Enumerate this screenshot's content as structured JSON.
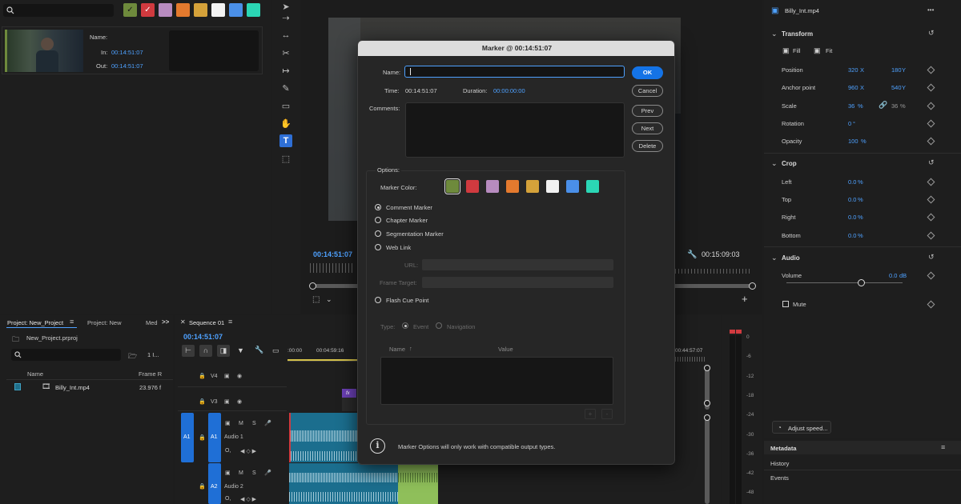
{
  "source_panel": {
    "search_placeholder": "",
    "label_colors": [
      "#6e8a3c",
      "#d03a3f",
      "#b78bbf",
      "#e47a2e",
      "#d5a23a",
      "#f2f2f2",
      "#4a8fe8",
      "#2bd6b5"
    ],
    "name_label": "Name:",
    "in_label": "In:",
    "in_value": "00:14:51:07",
    "out_label": "Out:",
    "out_value": "00:14:51:07"
  },
  "program_monitor": {
    "current_time": "00:14:51:07",
    "duration": "00:15:09:03"
  },
  "dialog": {
    "title": "Marker @ 00:14:51:07",
    "name_label": "Name:",
    "name_value": "",
    "time_label": "Time:",
    "time_value": "00:14:51:07",
    "duration_label": "Duration:",
    "duration_value": "00:00:00:00",
    "comments_label": "Comments:",
    "ok": "OK",
    "cancel": "Cancel",
    "prev": "Prev",
    "next": "Next",
    "delete": "Delete",
    "options_label": "Options:",
    "marker_color_label": "Marker Color:",
    "marker_colors": [
      "#6e8a3c",
      "#d03a3f",
      "#b78bbf",
      "#e47a2e",
      "#d5a23a",
      "#f2f2f2",
      "#4a8fe8",
      "#2bd6b5"
    ],
    "marker_types": [
      "Comment Marker",
      "Chapter Marker",
      "Segmentation Marker",
      "Web Link"
    ],
    "url_label": "URL:",
    "frame_target_label": "Frame Target:",
    "flash_cue_label": "Flash Cue Point",
    "type_label": "Type:",
    "type_event": "Event",
    "type_navigation": "Navigation",
    "col_name": "Name",
    "col_value": "Value",
    "add_symbol": "+",
    "remove_symbol": "-",
    "info_text": "Marker Options will only work with compatible output types."
  },
  "effect_controls": {
    "clip_name": "Billy_Int.mp4",
    "menu_glyph": "•••",
    "transform_label": "Transform",
    "fill_label": "Fill",
    "fit_label": "Fit",
    "position_label": "Position",
    "position_x": "320",
    "position_y": "180",
    "anchor_label": "Anchor point",
    "anchor_x": "960",
    "anchor_y": "540",
    "x_unit": "X",
    "y_unit": "Y",
    "scale_label": "Scale",
    "scale_value": "36",
    "scale_value2": "36",
    "pct_unit": "%",
    "rotation_label": "Rotation",
    "rotation_value": "0",
    "deg_unit": "°",
    "opacity_label": "Opacity",
    "opacity_value": "100",
    "crop_label": "Crop",
    "crop_left_label": "Left",
    "crop_left": "0.0",
    "crop_top_label": "Top",
    "crop_top": "0.0",
    "crop_right_label": "Right",
    "crop_right": "0.0",
    "crop_bottom_label": "Bottom",
    "crop_bottom": "0.0",
    "audio_label": "Audio",
    "volume_label": "Volume",
    "volume_value": "0.0",
    "db_unit": "dB",
    "mute_label": "Mute",
    "adjust_speed": "Adjust speed..."
  },
  "bottom_right": {
    "metadata": "Metadata",
    "history": "History",
    "events": "Events"
  },
  "project_panel": {
    "tab_project": "Project: New_Project",
    "tab_project2": "Project: New",
    "tab_media": "Med",
    "overflow": ">>",
    "file": "New_Project.prproj",
    "item_count": "1 I...",
    "col_name": "Name",
    "col_framerate": "Frame R",
    "item_name": "Billy_Int.mp4",
    "item_fps": "23.976 f"
  },
  "timeline": {
    "tab": "Sequence 01",
    "timecode": "00:14:51:07",
    "ruler_start": ":00:00",
    "ruler_mid": "00:04:59:16",
    "ruler_end": "00:44:57:07",
    "tracks": [
      {
        "id": "V4"
      },
      {
        "id": "V3"
      },
      {
        "id": "A1",
        "name": "Audio 1",
        "source": "A1"
      },
      {
        "id": "A2",
        "name": "Audio 2"
      }
    ],
    "fx_badge": "fx",
    "track_m": "M",
    "track_s": "S"
  },
  "meters": {
    "scale": [
      "0",
      "-6",
      "-12",
      "-18",
      "-24",
      "-30",
      "-36",
      "-42",
      "-48"
    ]
  }
}
